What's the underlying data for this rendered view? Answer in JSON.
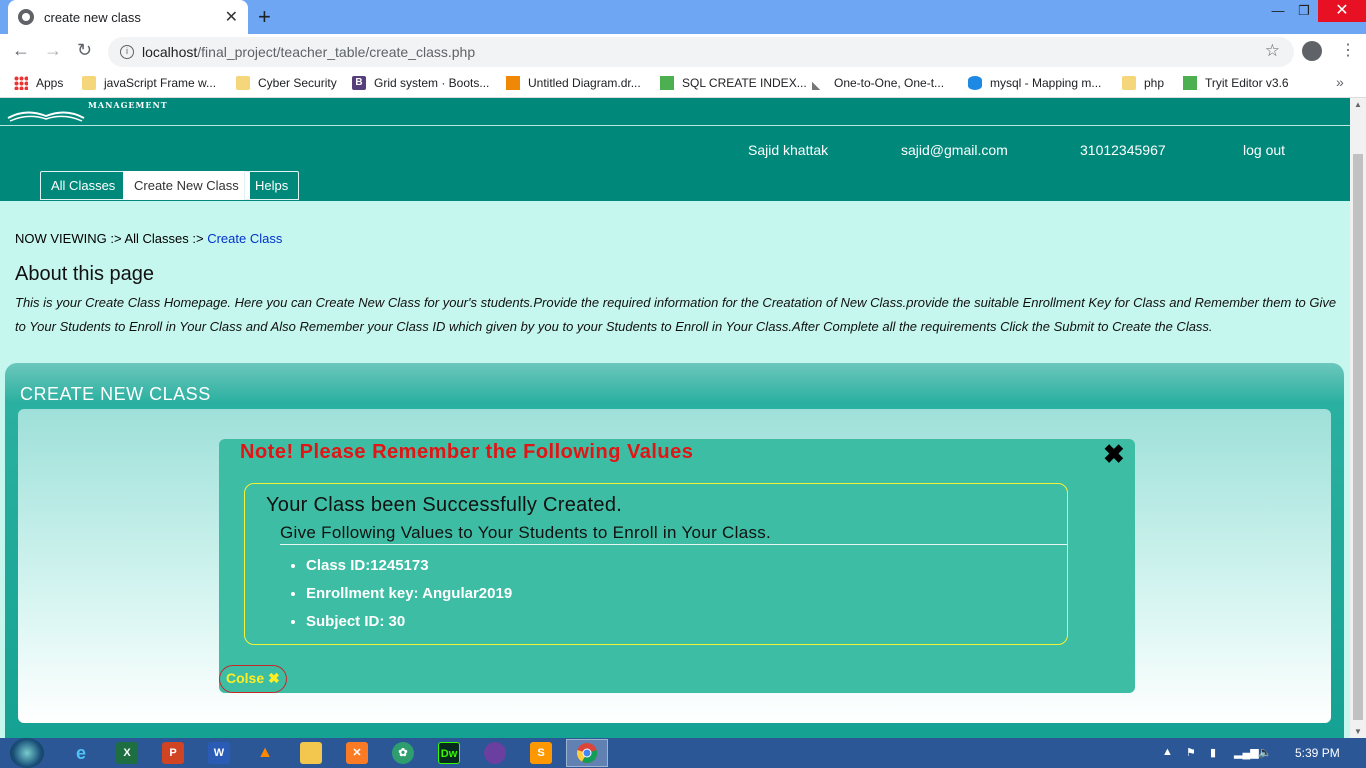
{
  "browser": {
    "tab_title": "create new class",
    "url_host": "localhost",
    "url_path": "/final_project/teacher_table/create_class.php",
    "bookmarks": [
      "Apps",
      "javaScript Frame w...",
      "Cyber Security",
      "Grid system · Boots...",
      "Untitled Diagram.dr...",
      "SQL CREATE INDEX...",
      "One-to-One, One-t...",
      "mysql - Mapping m...",
      "php",
      "Tryit Editor v3.6"
    ]
  },
  "header": {
    "logo_text": "MANAGEMENT",
    "user_name": "Sajid khattak",
    "user_email": "sajid@gmail.com",
    "user_phone": "31012345967",
    "logout": "log out",
    "tabs": [
      "All Classes",
      "Create New Class",
      "Helps"
    ]
  },
  "breadcrumb": {
    "prefix": "NOW VIEWING :>",
    "parent": "All Classes :>",
    "current": "Create Class"
  },
  "about": {
    "title": "About this page",
    "text": "This is your Create Class Homepage. Here you can Create New Class for your's students.Provide the required information for the Creatation of New Class.provide the suitable Enrollment Key for Class and Remember them to Give to Your Students to Enroll in Your Class and Also Remember your Class ID which given by you to your Students to Enroll in Your Class.After Complete all the requirements Click the Submit to Create the Class."
  },
  "panel": {
    "title": "CREATE NEW CLASS"
  },
  "modal": {
    "title": "Note! Please Remember the Following Values",
    "close_x": "✖",
    "success": "Your Class been Successfully Created.",
    "instruction": "Give Following Values to Your Students to Enroll in Your Class.",
    "values": [
      "Class ID:1245173",
      "Enrollment key: Angular2019",
      "Subject ID: 30"
    ],
    "close_button": "Colse ✖"
  },
  "taskbar": {
    "clock": "5:39 PM"
  }
}
